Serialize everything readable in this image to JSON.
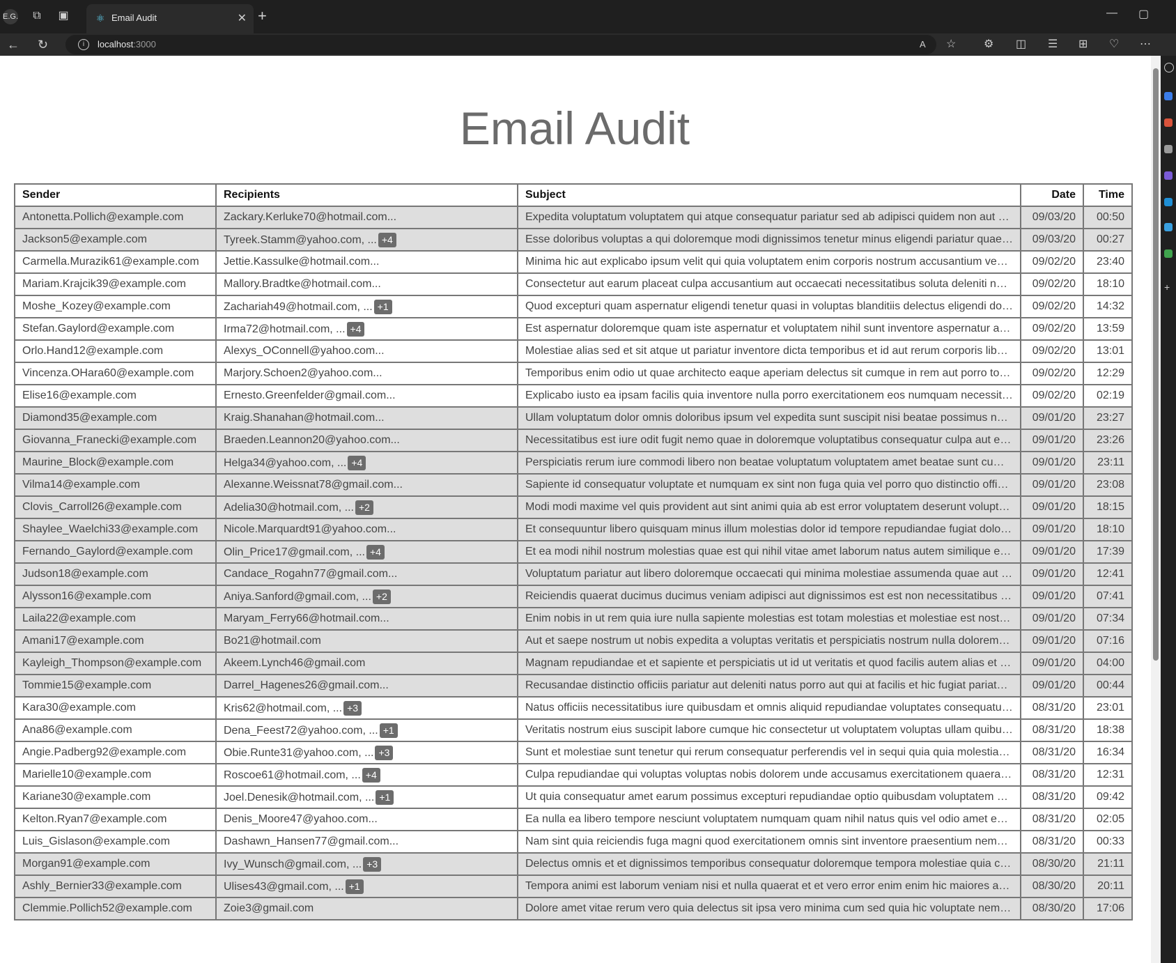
{
  "browser": {
    "profile": "E.G.",
    "tab_title": "Email Audit",
    "url_host": "localhost",
    "url_port": ":3000"
  },
  "page": {
    "title": "Email Audit",
    "columns": [
      "Sender",
      "Recipients",
      "Subject",
      "Date",
      "Time"
    ],
    "rows": [
      {
        "sender": "Antonetta.Pollich@example.com",
        "recipients": "Zackary.Kerluke70@hotmail.com...",
        "badge": "",
        "subject": "Expedita voluptatum voluptatem qui atque consequatur pariatur sed ab adipisci quidem non aut est ...",
        "date": "09/03/20",
        "time": "00:50",
        "shade": "g"
      },
      {
        "sender": "Jackson5@example.com",
        "recipients": "Tyreek.Stamm@yahoo.com, ...",
        "badge": "+4",
        "subject": "Esse doloribus voluptas a qui doloremque modi dignissimos tenetur minus eligendi pariatur quae e...",
        "date": "09/03/20",
        "time": "00:27",
        "shade": "g"
      },
      {
        "sender": "Carmella.Murazik61@example.com",
        "recipients": "Jettie.Kassulke@hotmail.com...",
        "badge": "",
        "subject": "Minima hic aut explicabo ipsum velit qui quia voluptatem enim corporis nostrum accusantium venia...",
        "date": "09/02/20",
        "time": "23:40",
        "shade": "w"
      },
      {
        "sender": "Mariam.Krajcik39@example.com",
        "recipients": "Mallory.Bradtke@hotmail.com...",
        "badge": "",
        "subject": "Consectetur aut earum placeat culpa accusantium aut occaecati necessitatibus soluta deleniti non ...",
        "date": "09/02/20",
        "time": "18:10",
        "shade": "w"
      },
      {
        "sender": "Moshe_Kozey@example.com",
        "recipients": "Zachariah49@hotmail.com, ...",
        "badge": "+1",
        "subject": "Quod excepturi quam aspernatur eligendi tenetur quasi in voluptas blanditiis delectus eligendi dolor...",
        "date": "09/02/20",
        "time": "14:32",
        "shade": "w"
      },
      {
        "sender": "Stefan.Gaylord@example.com",
        "recipients": "Irma72@hotmail.com, ...",
        "badge": "+4",
        "subject": "Est aspernatur doloremque quam iste aspernatur et voluptatem nihil sunt inventore aspernatur animi...",
        "date": "09/02/20",
        "time": "13:59",
        "shade": "w"
      },
      {
        "sender": "Orlo.Hand12@example.com",
        "recipients": "Alexys_OConnell@yahoo.com...",
        "badge": "",
        "subject": "Molestiae alias sed et sit atque ut pariatur inventore dicta temporibus et id aut rerum corporis libero...",
        "date": "09/02/20",
        "time": "13:01",
        "shade": "w"
      },
      {
        "sender": "Vincenza.OHara60@example.com",
        "recipients": "Marjory.Schoen2@yahoo.com...",
        "badge": "",
        "subject": "Temporibus enim odio ut quae architecto eaque aperiam delectus sit cumque in rem aut porro tota...",
        "date": "09/02/20",
        "time": "12:29",
        "shade": "w"
      },
      {
        "sender": "Elise16@example.com",
        "recipients": "Ernesto.Greenfelder@gmail.com...",
        "badge": "",
        "subject": "Explicabo iusto ea ipsam facilis quia inventore nulla porro exercitationem eos numquam necessitati...",
        "date": "09/02/20",
        "time": "02:19",
        "shade": "w"
      },
      {
        "sender": "Diamond35@example.com",
        "recipients": "Kraig.Shanahan@hotmail.com...",
        "badge": "",
        "subject": "Ullam voluptatum dolor omnis doloribus ipsum vel expedita sunt suscipit nisi beatae possimus nostr...",
        "date": "09/01/20",
        "time": "23:27",
        "shade": "g"
      },
      {
        "sender": "Giovanna_Franecki@example.com",
        "recipients": "Braeden.Leannon20@yahoo.com...",
        "badge": "",
        "subject": "Necessitatibus est iure odit fugit nemo quae in doloremque voluptatibus consequatur culpa aut et s...",
        "date": "09/01/20",
        "time": "23:26",
        "shade": "g"
      },
      {
        "sender": "Maurine_Block@example.com",
        "recipients": "Helga34@yahoo.com, ...",
        "badge": "+4",
        "subject": "Perspiciatis rerum iure commodi libero non beatae voluptatum voluptatem amet beatae sunt cum q...",
        "date": "09/01/20",
        "time": "23:11",
        "shade": "g"
      },
      {
        "sender": "Vilma14@example.com",
        "recipients": "Alexanne.Weissnat78@gmail.com...",
        "badge": "",
        "subject": "Sapiente id consequatur voluptate et numquam ex sint non fuga quia vel porro quo distinctio officiis ...",
        "date": "09/01/20",
        "time": "23:08",
        "shade": "g"
      },
      {
        "sender": "Clovis_Carroll26@example.com",
        "recipients": "Adelia30@hotmail.com, ...",
        "badge": "+2",
        "subject": "Modi modi maxime vel quis provident aut sint animi quia ab est error voluptatem deserunt voluptate...",
        "date": "09/01/20",
        "time": "18:15",
        "shade": "g"
      },
      {
        "sender": "Shaylee_Waelchi33@example.com",
        "recipients": "Nicole.Marquardt91@yahoo.com...",
        "badge": "",
        "subject": "Et consequuntur libero quisquam minus illum molestias dolor id tempore repudiandae fugiat doloru...",
        "date": "09/01/20",
        "time": "18:10",
        "shade": "g"
      },
      {
        "sender": "Fernando_Gaylord@example.com",
        "recipients": "Olin_Price17@gmail.com, ...",
        "badge": "+4",
        "subject": "Et ea modi nihil nostrum molestias quae est qui nihil vitae amet laborum natus autem similique eni...",
        "date": "09/01/20",
        "time": "17:39",
        "shade": "g"
      },
      {
        "sender": "Judson18@example.com",
        "recipients": "Candace_Rogahn77@gmail.com...",
        "badge": "",
        "subject": "Voluptatum pariatur aut libero doloremque occaecati qui minima molestiae assumenda quae aut hi...",
        "date": "09/01/20",
        "time": "12:41",
        "shade": "g"
      },
      {
        "sender": "Alysson16@example.com",
        "recipients": "Aniya.Sanford@gmail.com, ...",
        "badge": "+2",
        "subject": "Reiciendis quaerat ducimus ducimus veniam adipisci aut dignissimos est est non necessitatibus of...",
        "date": "09/01/20",
        "time": "07:41",
        "shade": "g"
      },
      {
        "sender": "Laila22@example.com",
        "recipients": "Maryam_Ferry66@hotmail.com...",
        "badge": "",
        "subject": "Enim nobis in ut rem quia iure nulla sapiente molestias est totam molestias et molestiae est nostru...",
        "date": "09/01/20",
        "time": "07:34",
        "shade": "g"
      },
      {
        "sender": "Amani17@example.com",
        "recipients": "Bo21@hotmail.com",
        "badge": "",
        "subject": "Aut et saepe nostrum ut nobis expedita a voluptas veritatis et perspiciatis nostrum nulla doloremque...",
        "date": "09/01/20",
        "time": "07:16",
        "shade": "g"
      },
      {
        "sender": "Kayleigh_Thompson@example.com",
        "recipients": "Akeem.Lynch46@gmail.com",
        "badge": "",
        "subject": "Magnam repudiandae et et sapiente et perspiciatis ut id ut veritatis et quod facilis autem alias et la...",
        "date": "09/01/20",
        "time": "04:00",
        "shade": "g"
      },
      {
        "sender": "Tommie15@example.com",
        "recipients": "Darrel_Hagenes26@gmail.com...",
        "badge": "",
        "subject": "Recusandae distinctio officiis pariatur aut deleniti natus porro aut qui at facilis et hic fugiat pariatur ...",
        "date": "09/01/20",
        "time": "00:44",
        "shade": "g"
      },
      {
        "sender": "Kara30@example.com",
        "recipients": "Kris62@hotmail.com, ...",
        "badge": "+3",
        "subject": "Natus officiis necessitatibus iure quibusdam et omnis aliquid repudiandae voluptates consequatur l...",
        "date": "08/31/20",
        "time": "23:01",
        "shade": "w"
      },
      {
        "sender": "Ana86@example.com",
        "recipients": "Dena_Feest72@yahoo.com, ...",
        "badge": "+1",
        "subject": "Veritatis nostrum eius suscipit labore cumque hic consectetur ut voluptatem voluptas ullam quibusd...",
        "date": "08/31/20",
        "time": "18:38",
        "shade": "w"
      },
      {
        "sender": "Angie.Padberg92@example.com",
        "recipients": "Obie.Runte31@yahoo.com, ...",
        "badge": "+3",
        "subject": "Sunt et molestiae sunt tenetur qui rerum consequatur perferendis vel in sequi quia quia molestiae o...",
        "date": "08/31/20",
        "time": "16:34",
        "shade": "w"
      },
      {
        "sender": "Marielle10@example.com",
        "recipients": "Roscoe61@hotmail.com, ...",
        "badge": "+4",
        "subject": "Culpa repudiandae qui voluptas voluptas nobis dolorem unde accusamus exercitationem quaerat v...",
        "date": "08/31/20",
        "time": "12:31",
        "shade": "w"
      },
      {
        "sender": "Kariane30@example.com",
        "recipients": "Joel.Denesik@hotmail.com, ...",
        "badge": "+1",
        "subject": "Ut quia consequatur amet earum possimus excepturi repudiandae optio quibusdam voluptatem par...",
        "date": "08/31/20",
        "time": "09:42",
        "shade": "w"
      },
      {
        "sender": "Kelton.Ryan7@example.com",
        "recipients": "Denis_Moore47@yahoo.com...",
        "badge": "",
        "subject": "Ea nulla ea libero tempore nesciunt voluptatem numquam quam nihil natus quis vel odio amet esse ...",
        "date": "08/31/20",
        "time": "02:05",
        "shade": "w"
      },
      {
        "sender": "Luis_Gislason@example.com",
        "recipients": "Dashawn_Hansen77@gmail.com...",
        "badge": "",
        "subject": "Nam sint quia reiciendis fuga magni quod exercitationem omnis sint inventore praesentium nemo d...",
        "date": "08/31/20",
        "time": "00:33",
        "shade": "w"
      },
      {
        "sender": "Morgan91@example.com",
        "recipients": "Ivy_Wunsch@gmail.com, ...",
        "badge": "+3",
        "subject": "Delectus omnis et et dignissimos temporibus consequatur doloremque tempora molestiae quia con...",
        "date": "08/30/20",
        "time": "21:11",
        "shade": "g"
      },
      {
        "sender": "Ashly_Bernier33@example.com",
        "recipients": "Ulises43@gmail.com, ...",
        "badge": "+1",
        "subject": "Tempora animi est laborum veniam nisi et nulla quaerat et et vero error enim enim hic maiores ab c...",
        "date": "08/30/20",
        "time": "20:11",
        "shade": "g"
      },
      {
        "sender": "Clemmie.Pollich52@example.com",
        "recipients": "Zoie3@gmail.com",
        "badge": "",
        "subject": "Dolore amet vitae rerum vero quia delectus sit ipsa vero minima cum sed quia hic voluptate nemo d...",
        "date": "08/30/20",
        "time": "17:06",
        "shade": "g"
      }
    ]
  }
}
